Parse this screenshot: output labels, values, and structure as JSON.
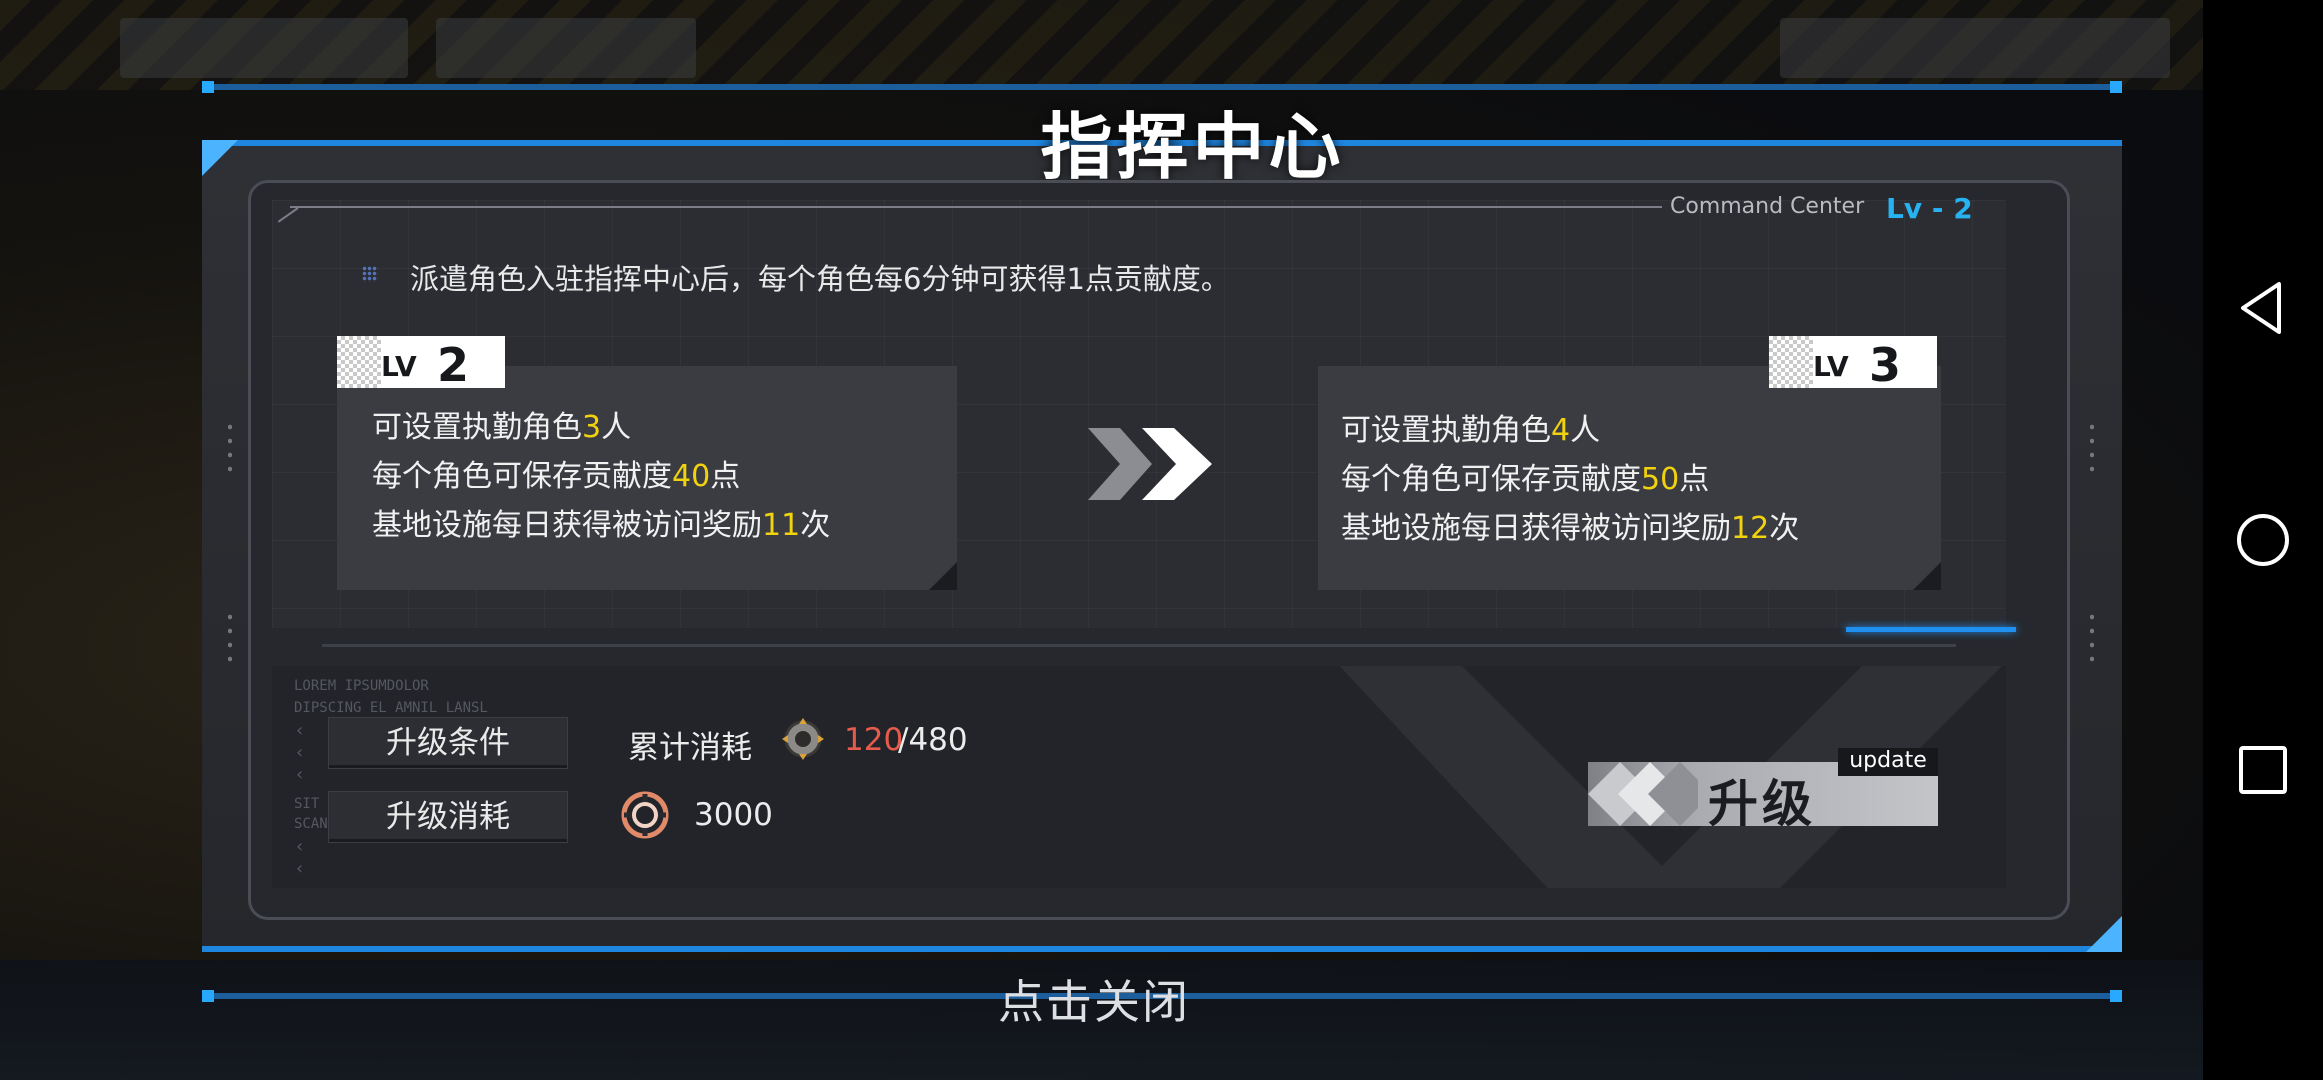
{
  "modal": {
    "title": "指挥中心",
    "subtitle_en": "Command Center",
    "current_level_tag": "Lv - 2",
    "description": "派遣角色入驻指挥中心后，每个角色每6分钟可获得1点贡献度。",
    "current": {
      "lv_prefix": "LV",
      "level": "2",
      "line1_pre": "可设置执勤角色",
      "line1_val": "3",
      "line1_post": "人",
      "line2_pre": "每个角色可保存贡献度",
      "line2_val": "40",
      "line2_post": "点",
      "line3_pre": "基地设施每日获得被访问奖励",
      "line3_val": "11",
      "line3_post": "次"
    },
    "next": {
      "lv_prefix": "LV",
      "level": "3",
      "line1_pre": "可设置执勤角色",
      "line1_val": "4",
      "line1_post": "人",
      "line2_pre": "每个角色可保存贡献度",
      "line2_val": "50",
      "line2_post": "点",
      "line3_pre": "基地设施每日获得被访问奖励",
      "line3_val": "12",
      "line3_post": "次"
    },
    "upgrade": {
      "requirement_button": "升级条件",
      "cost_button": "升级消耗",
      "requirement_label": "累计消耗",
      "requirement_current": "120",
      "requirement_total": "/480",
      "cost_value": "3000",
      "action_label": "升级",
      "action_tag": "update"
    },
    "deco_text": [
      "LOREM  IPSUMDOLOR",
      "DIPSCING EL  AMNIL LANSL",
      "SIT AMET, CONSECTETUR",
      "SCAN SERVE"
    ],
    "close_hint": "点击关闭"
  },
  "colors": {
    "accent_blue": "#1f86e0",
    "highlight_yellow": "#f1d20f",
    "insufficient_red": "#e55c4d",
    "level_tag_blue": "#27b3f2"
  },
  "icons": {
    "requirement": "gear-material-icon",
    "cost": "coin-currency-icon",
    "arrow": "double-chevron-right-icon",
    "nav": [
      "back-triangle-icon",
      "home-circle-icon",
      "recents-square-icon"
    ]
  }
}
